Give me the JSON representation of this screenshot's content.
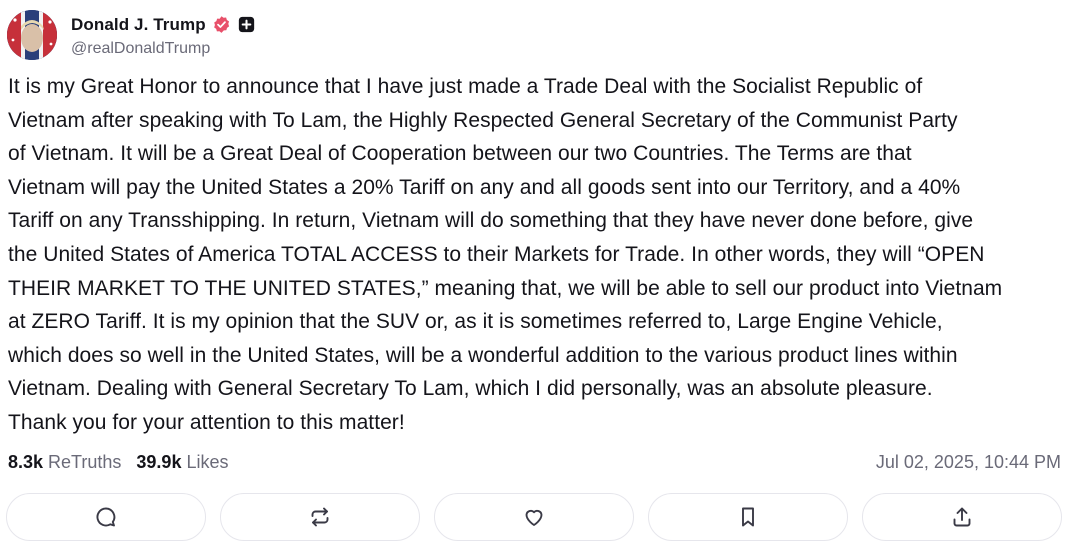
{
  "post": {
    "author": {
      "display_name": "Donald J. Trump",
      "handle": "@realDonaldTrump",
      "verified_icon": "verified-badge-icon",
      "extra_badge_icon": "plus-badge-icon"
    },
    "lines": [
      "It is my Great Honor to announce that I have just made a Trade Deal with the Socialist Republic of",
      "Vietnam after speaking with To Lam, the Highly Respected General Secretary of the Communist Party",
      "of Vietnam. It will be a Great Deal of Cooperation between our two Countries. The Terms are that",
      "Vietnam will pay the United States a 20% Tariff on any and all goods sent into our Territory, and a 40%",
      "Tariff on any Transshipping. In return, Vietnam will do something that they have never done before, give",
      "the United States of America TOTAL ACCESS to their Markets for Trade. In other words, they will “OPEN",
      "THEIR MARKET TO THE UNITED STATES,” meaning that, we will be able to sell our product into Vietnam",
      "at ZERO Tariff. It is my opinion that the SUV or, as it is sometimes referred to, Large Engine Vehicle,",
      "which does so well in the United States, will be a wonderful addition to the various product lines within",
      "Vietnam. Dealing with General Secretary To Lam, which I did personally, was an absolute pleasure.",
      "Thank you for your attention to this matter!"
    ],
    "stats": {
      "retruths_count": "8.3k",
      "retruths_label": "ReTruths",
      "likes_count": "39.9k",
      "likes_label": "Likes"
    },
    "timestamp": "Jul 02, 2025, 10:44 PM"
  },
  "actions": [
    {
      "name": "reply-button",
      "icon": "comment-icon"
    },
    {
      "name": "retruth-button",
      "icon": "repost-icon"
    },
    {
      "name": "like-button",
      "icon": "heart-icon"
    },
    {
      "name": "bookmark-button",
      "icon": "bookmark-icon"
    },
    {
      "name": "share-button",
      "icon": "share-icon"
    }
  ],
  "colors": {
    "text": "#14141a",
    "muted": "#6a6a78",
    "verified": "#e8506a",
    "border": "#e6e6ec"
  }
}
